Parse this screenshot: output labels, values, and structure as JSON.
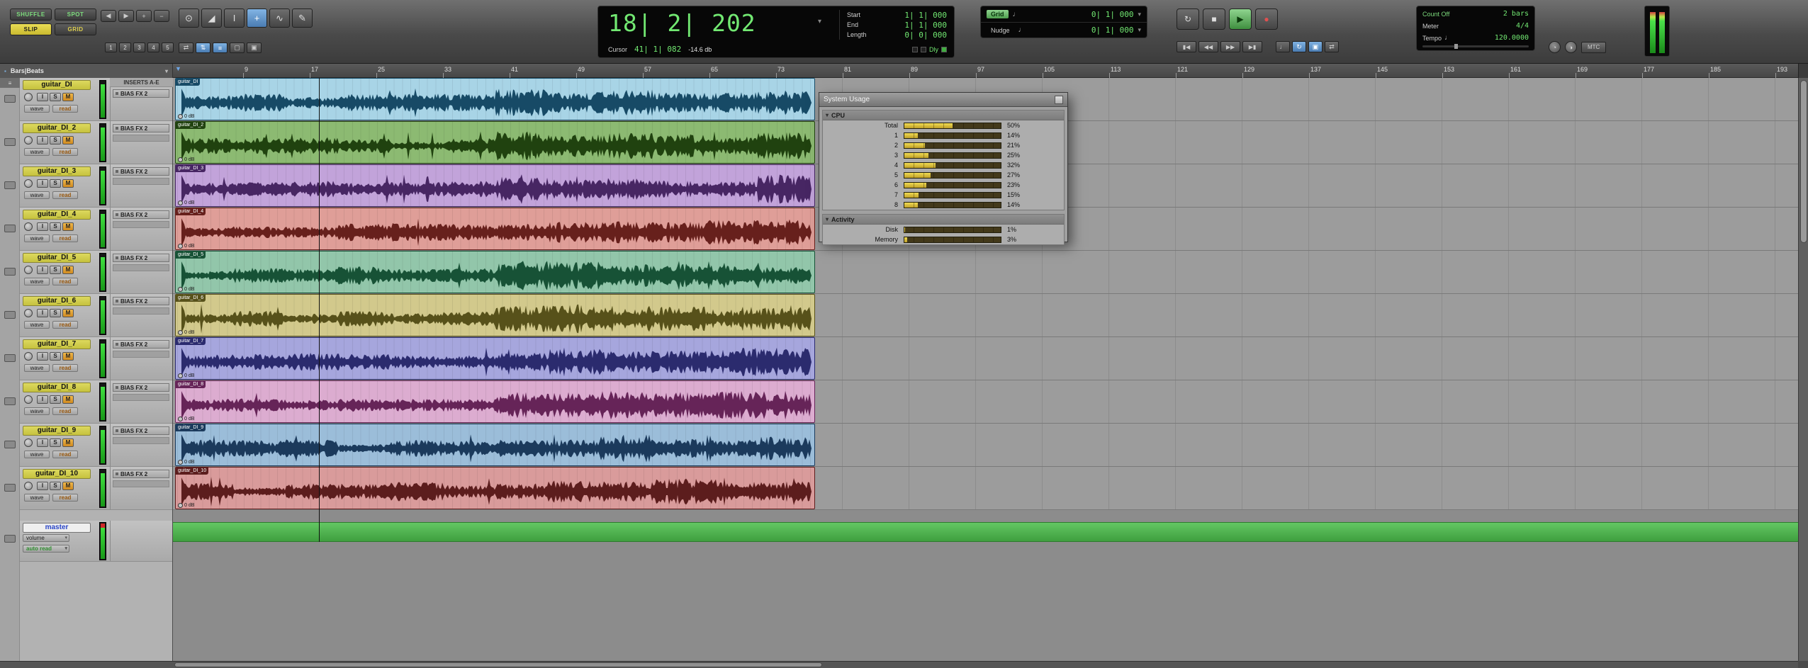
{
  "toolbar": {
    "modes": [
      {
        "label": "SHUFFLE",
        "state": "green"
      },
      {
        "label": "SPOT",
        "state": "green"
      },
      {
        "label": "SLIP",
        "state": "selected"
      },
      {
        "label": "GRID",
        "state": "yellow"
      }
    ],
    "nav": [
      "◀",
      "▶",
      "+",
      "−"
    ],
    "zoom_presets": [
      "1",
      "2",
      "3",
      "4",
      "5"
    ],
    "tools": [
      {
        "glyph": "⊙",
        "name": "zoom-tool",
        "sel": false
      },
      {
        "glyph": "◢",
        "name": "trim-tool",
        "sel": false
      },
      {
        "glyph": "I",
        "name": "selector-tool",
        "sel": false
      },
      {
        "glyph": "+",
        "name": "grabber-tool",
        "sel": true
      },
      {
        "glyph": "∿",
        "name": "scrub-tool",
        "sel": false
      },
      {
        "glyph": "✎",
        "name": "pencil-tool",
        "sel": false
      }
    ],
    "link_buttons": [
      {
        "glyph": "⇄",
        "name": "link-timeline-edit-button",
        "sel": false
      },
      {
        "glyph": "⇅",
        "name": "link-track-edit-selection-button",
        "sel": true
      },
      {
        "glyph": "≡",
        "name": "mirror-midi-button",
        "sel": true
      },
      {
        "glyph": "▢",
        "name": "tab-to-transient-button",
        "sel": false
      },
      {
        "glyph": "▣",
        "name": "insertion-follows-playback-button",
        "sel": false
      }
    ],
    "counter": {
      "main": "18| 2| 202",
      "start_label": "Start",
      "start": "1| 1| 000",
      "end_label": "End",
      "end": "1| 1| 000",
      "length_label": "Length",
      "length": "0| 0| 000",
      "cursor_label": "Cursor",
      "cursor": "41| 1| 082",
      "cursor_level": "-14.6 db",
      "dly": "Dly"
    },
    "grid_nudge": {
      "grid_label": "Grid",
      "grid_value": "0| 1| 000",
      "nudge_label": "Nudge",
      "nudge_value": "0| 1| 000",
      "note": "♩"
    },
    "transport": {
      "main": [
        {
          "glyph": "↻",
          "name": "online-button",
          "sel": false
        },
        {
          "glyph": "■",
          "name": "stop-button",
          "sel": false
        },
        {
          "glyph": "▶",
          "name": "play-button",
          "sel": true
        },
        {
          "glyph": "●",
          "name": "record-button",
          "rec": true
        }
      ],
      "small": [
        {
          "glyph": "▮◀",
          "name": "return-to-zero-button"
        },
        {
          "glyph": "◀◀",
          "name": "rewind-button"
        },
        {
          "glyph": "▶▶",
          "name": "fast-forward-button"
        },
        {
          "glyph": "▶▮",
          "name": "go-to-end-button"
        }
      ],
      "toggles": [
        {
          "glyph": "♩",
          "name": "metronome-button",
          "sel": false
        },
        {
          "glyph": "↻",
          "name": "loop-playback-button",
          "sel": true
        },
        {
          "glyph": "▣",
          "name": "pre-roll-button",
          "sel": true
        },
        {
          "glyph": "⇄",
          "name": "midi-merge-button",
          "sel": false
        }
      ]
    },
    "session": {
      "count_off_label": "Count Off",
      "count_off": "2 bars",
      "meter_label": "Meter",
      "meter": "4/4",
      "tempo_label": "Tempo",
      "tempo_note": "♩",
      "tempo": "120.0000"
    },
    "mtc": "MTC"
  },
  "ruler": {
    "label": "Bars|Beats",
    "ticks": [
      9,
      17,
      25,
      33,
      41,
      49,
      57,
      65,
      73,
      81,
      89,
      97,
      105,
      113,
      121,
      129,
      137,
      145,
      153,
      161,
      169,
      177,
      185,
      193
    ]
  },
  "inserts_header": "INSERTS A-E",
  "track_controls": {
    "input": "I",
    "solo": "S",
    "mute": "M",
    "wave": "wave",
    "read": "read"
  },
  "tracks": [
    {
      "name": "guitar_DI",
      "insert": "BIAS FX 2",
      "clip_label": "guitar_DI",
      "gain": "0 dB",
      "clip_bg": "#a8d4e6",
      "wave_color": "#174a66"
    },
    {
      "name": "guitar_DI_2",
      "insert": "BIAS FX 2",
      "clip_label": "guitar_DI_2",
      "gain": "0 dB",
      "clip_bg": "#8cba72",
      "wave_color": "#20420f"
    },
    {
      "name": "guitar_DI_3",
      "insert": "BIAS FX 2",
      "clip_label": "guitar_DI_3",
      "gain": "0 dB",
      "clip_bg": "#c2a3da",
      "wave_color": "#472663"
    },
    {
      "name": "guitar_DI_4",
      "insert": "BIAS FX 2",
      "clip_label": "guitar_DI_4",
      "gain": "0 dB",
      "clip_bg": "#df9e98",
      "wave_color": "#67201c"
    },
    {
      "name": "guitar_DI_5",
      "insert": "BIAS FX 2",
      "clip_label": "guitar_DI_5",
      "gain": "0 dB",
      "clip_bg": "#92c6aa",
      "wave_color": "#175236"
    },
    {
      "name": "guitar_DI_6",
      "insert": "BIAS FX 2",
      "clip_label": "guitar_DI_6",
      "gain": "0 dB",
      "clip_bg": "#d2c98c",
      "wave_color": "#57511a"
    },
    {
      "name": "guitar_DI_7",
      "insert": "BIAS FX 2",
      "clip_label": "guitar_DI_7",
      "gain": "0 dB",
      "clip_bg": "#a6a6dd",
      "wave_color": "#2b2b6e"
    },
    {
      "name": "guitar_DI_8",
      "insert": "BIAS FX 2",
      "clip_label": "guitar_DI_8",
      "gain": "0 dB",
      "clip_bg": "#dcacd0",
      "wave_color": "#662458"
    },
    {
      "name": "guitar_DI_9",
      "insert": "BIAS FX 2",
      "clip_label": "guitar_DI_9",
      "gain": "0 dB",
      "clip_bg": "#9bbdd9",
      "wave_color": "#1b3a5c"
    },
    {
      "name": "guitar_DI_10",
      "insert": "BIAS FX 2",
      "clip_label": "guitar_DI_10",
      "gain": "0 dB",
      "clip_bg": "#d99b9b",
      "wave_color": "#5c1d1d"
    }
  ],
  "master": {
    "name": "master",
    "volume": "volume",
    "automation": "auto read"
  },
  "system_usage": {
    "title": "System Usage",
    "cpu_label": "CPU",
    "activity_label": "Activity",
    "cpu_rows": [
      {
        "label": "Total",
        "value": "50%",
        "pct": 50
      },
      {
        "label": "1",
        "value": "14%",
        "pct": 14
      },
      {
        "label": "2",
        "value": "21%",
        "pct": 21
      },
      {
        "label": "3",
        "value": "25%",
        "pct": 25
      },
      {
        "label": "4",
        "value": "32%",
        "pct": 32
      },
      {
        "label": "5",
        "value": "27%",
        "pct": 27
      },
      {
        "label": "6",
        "value": "23%",
        "pct": 23
      },
      {
        "label": "7",
        "value": "15%",
        "pct": 15
      },
      {
        "label": "8",
        "value": "14%",
        "pct": 14
      }
    ],
    "activity_rows": [
      {
        "label": "Disk",
        "value": "1%",
        "pct": 1
      },
      {
        "label": "Memory",
        "value": "3%",
        "pct": 3
      }
    ]
  }
}
